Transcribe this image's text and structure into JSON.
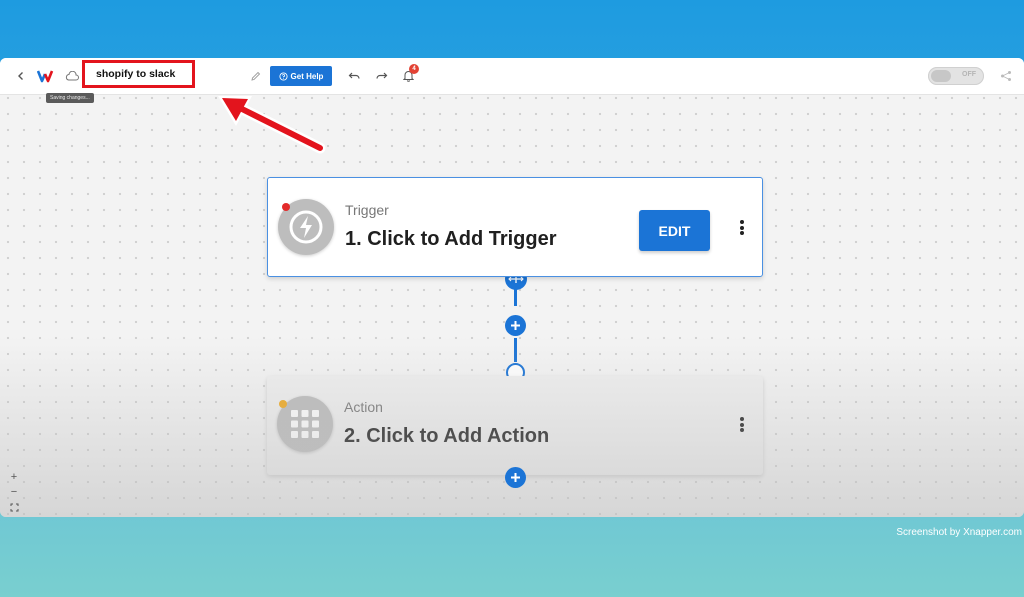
{
  "header": {
    "workflow_title": "shopify to slack",
    "saving_tooltip": "Saving changes...",
    "help_label": "Get Help",
    "notification_count": "4",
    "toggle_label": "OFF"
  },
  "trigger": {
    "type_label": "Trigger",
    "title": "1. Click to Add Trigger",
    "edit_label": "EDIT"
  },
  "action": {
    "type_label": "Action",
    "title": "2. Click to Add Action"
  },
  "zoom": {
    "in_label": "+",
    "out_label": "−"
  },
  "footer": {
    "credit": "Screenshot by Xnapper.com"
  },
  "colors": {
    "accent": "#1b74d6",
    "annotation_red": "#e3141d",
    "status_error": "#e32b2b",
    "status_warning": "#f0a91e"
  },
  "icons": [
    "back-chevron-icon",
    "brand-logo-icon",
    "cloud-icon",
    "pencil-icon",
    "help-circle-icon",
    "undo-icon",
    "redo-icon",
    "bell-icon",
    "share-icon",
    "lightning-icon",
    "apps-grid-icon",
    "more-vertical-icon",
    "plus-icon",
    "fit-screen-icon"
  ]
}
